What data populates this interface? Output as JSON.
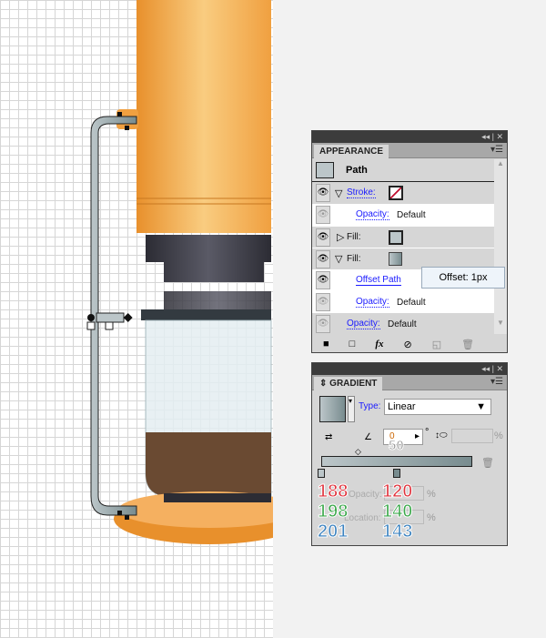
{
  "appearance": {
    "title": "APPEARANCE",
    "path_label": "Path",
    "stroke_label": "Stroke:",
    "opacity_label": "Opacity:",
    "default_value": "Default",
    "fill_label": "Fill:",
    "offset_path_label": "Offset Path",
    "tooltip": "Offset: 1px",
    "fx_label": "fx"
  },
  "gradient": {
    "title": "GRADIENT",
    "type_label": "Type:",
    "type_value": "Linear",
    "angle_value": "0",
    "degree": "°",
    "percent": "%",
    "opacity_label": "Opacity:",
    "location_label": "Location:",
    "midpoint_overlay": "50",
    "stop1": {
      "r": "188",
      "g": "198",
      "b": "201"
    },
    "stop2": {
      "r": "120",
      "g": "140",
      "b": "143"
    }
  },
  "colors": {
    "panel": "#d6d6d6",
    "orange": "#f0a040",
    "path_fill": "#bcc6c9",
    "path_dark": "#788c8f",
    "link": "#1a1aff",
    "red": "#e0323c",
    "green": "#3aa84a",
    "blue": "#3a82c0"
  }
}
